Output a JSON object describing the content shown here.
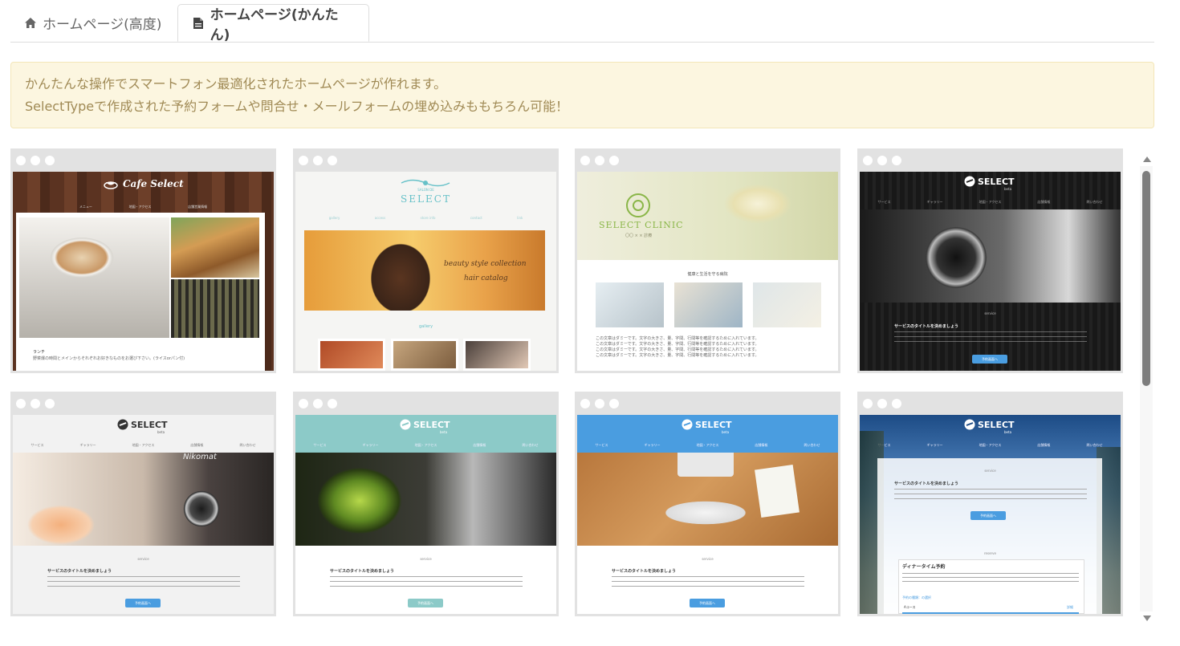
{
  "tabs": [
    {
      "label": "ホームページ(高度)",
      "icon": "home-icon"
    },
    {
      "label": "ホームページ(かんたん)",
      "icon": "document-icon",
      "active": true
    }
  ],
  "notice": {
    "line1": "かんたんな操作でスマートフォン最適化されたホームページが作れます。",
    "line2": "SelectTypeで作成された予約フォームや問合せ・メールフォームの埋め込みももちろん可能！"
  },
  "templates": [
    {
      "logo": "Cafe Select",
      "nav": [
        "メニュー",
        "地図・アクセス",
        "店舗営業情報"
      ],
      "caption_title": "ランチ",
      "caption_body": "野菜爆の時間とメインからそれぞれお好きなものをお選び下さい。(ライスorパン付)"
    },
    {
      "logo_small": "SALON DE",
      "logo": "SELECT",
      "nav": [
        "gallery",
        "access",
        "store info",
        "contact",
        "link"
      ],
      "image_text_1": "beauty style collection",
      "image_text_2": "hair catalog",
      "section": "gallery"
    },
    {
      "logo": "SELECT CLINIC",
      "logo_sub": "〇〇 × × 診療",
      "section_title": "健康と生活を守る病院",
      "body": "この文章はダミーです。文字の大きさ、量、字間、行間等を確認するために入れています。"
    },
    {
      "logo": "SELECT",
      "logo_sub": "beta",
      "nav": [
        "サービス",
        "ギャラリー",
        "地図・アクセス",
        "店舗情報",
        "問い合わせ"
      ],
      "section": "service",
      "title": "サービスのタイトルを決めましょう",
      "button": "予約画面へ"
    },
    {
      "logo": "SELECT",
      "logo_sub": "beta",
      "nav": [
        "サービス",
        "ギャラリー",
        "地図・アクセス",
        "店舗情報",
        "問い合わせ"
      ],
      "camera_text": "Nikomat",
      "section": "service",
      "title": "サービスのタイトルを決めましょう",
      "button": "予約画面へ"
    },
    {
      "logo": "SELECT",
      "logo_sub": "beta",
      "nav": [
        "サービス",
        "ギャラリー",
        "地図・アクセス",
        "店舗情報",
        "問い合わせ"
      ],
      "section": "service",
      "title": "サービスのタイトルを決めましょう",
      "button": "予約画面へ"
    },
    {
      "logo": "SELECT",
      "logo_sub": "beta",
      "nav": [
        "サービス",
        "ギャラリー",
        "地図・アクセス",
        "店舗情報",
        "問い合わせ"
      ],
      "section": "service",
      "title": "サービスのタイトルを決めましょう",
      "button": "予約画面へ"
    },
    {
      "logo": "SELECT",
      "logo_sub": "beta",
      "nav": [
        "サービス",
        "ギャラリー",
        "地図・アクセス",
        "店舗情報",
        "問い合わせ"
      ],
      "section": "service",
      "title": "サービスのタイトルを決めましょう",
      "button": "予約画面へ",
      "reserve_section": "reserve",
      "reserve_title": "ディナータイム予約",
      "reserve_link": "予約の種類：の選択",
      "reserve_course": "Aコース",
      "reserve_detail": "詳細"
    }
  ],
  "colors": {
    "teal": "#8ccac8",
    "blue": "#4a9de0",
    "notice_bg": "#fcf6e0",
    "notice_text": "#a08a55"
  }
}
